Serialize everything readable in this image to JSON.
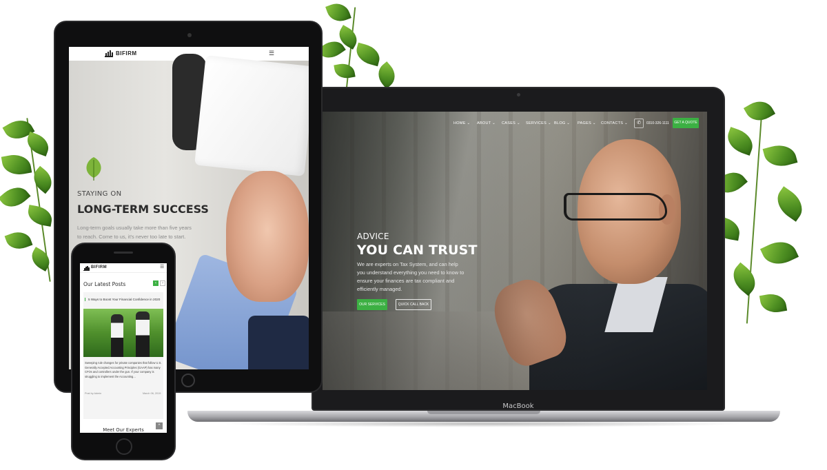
{
  "laptop": {
    "brand": "MacBook",
    "nav": {
      "items": [
        "HOME",
        "ABOUT",
        "CASES",
        "SERVICES",
        "BLOG",
        "PAGES",
        "CONTACTS"
      ],
      "phone": "0310-326-1111",
      "quote_button": "GET A QUOTE"
    },
    "hero": {
      "eyebrow": "ADVICE",
      "title": "YOU CAN TRUST",
      "body": "We are experts on Tax System, and can help you understand everything you need to know to ensure your finances are tax compliant and efficiently managed.",
      "primary_button": "OUR SERVICES",
      "secondary_button": "QUICK CALL BACK"
    }
  },
  "tablet": {
    "logo": "BIFIRM",
    "menu_icon": "☰",
    "hero": {
      "eyebrow": "STAYING ON",
      "title": "LONG-TERM SUCCESS",
      "body": "Long-term goals usually take more than five years to reach. Come to us, it's never too late to start."
    }
  },
  "phone": {
    "logo": "BIFIRM",
    "menu_icon": "☰",
    "section_title": "Our Latest Posts",
    "post": {
      "title": "5 Ways to Boost Your Financial Confidence in 2020",
      "body": "Sweeping rule changes for private companies that follow U.S. Generally Accepted Accounting Principles (GAAP) has many CFOs and controllers under the gun. If your company is struggling to implement the Accounting...",
      "author": "Post by Admin",
      "date": "March 06, 2019"
    },
    "next_section": "Meet Our Experts"
  },
  "colors": {
    "accent": "#3cb043"
  }
}
